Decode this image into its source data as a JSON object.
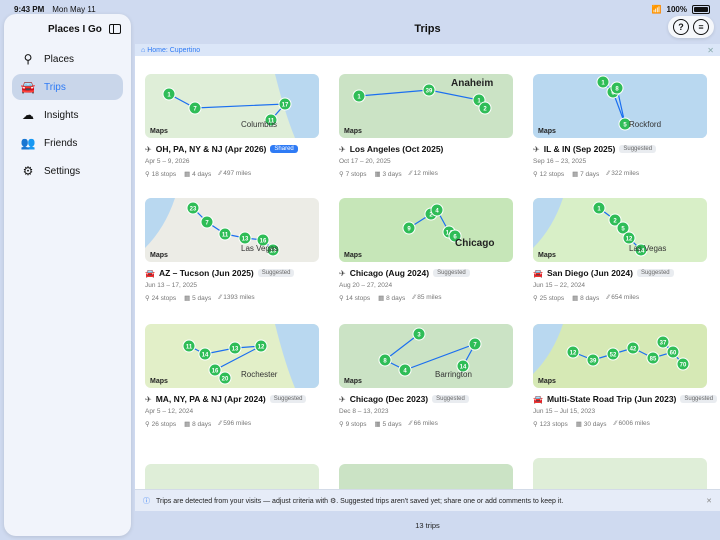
{
  "status": {
    "time": "9:43 PM",
    "date": "Mon May 11",
    "battery": "100%"
  },
  "sidebar": {
    "title": "Places I Go",
    "items": [
      {
        "label": "Places",
        "icon": "pin-icon",
        "glyph": "⚲"
      },
      {
        "label": "Trips",
        "icon": "car-icon",
        "glyph": "🚘"
      },
      {
        "label": "Insights",
        "icon": "brain-icon",
        "glyph": "☁"
      },
      {
        "label": "Friends",
        "icon": "people-icon",
        "glyph": "👥"
      },
      {
        "label": "Settings",
        "icon": "gear-icon",
        "glyph": "⚙"
      }
    ]
  },
  "header": {
    "title": "Trips",
    "help": "?",
    "menu": "≡"
  },
  "breadcrumb": {
    "label": "Home: Cupertino"
  },
  "cards": [
    {
      "title": "OH, PA, NY & NJ (Apr 2026)",
      "type": "plane",
      "badge": "Shared",
      "date": "Apr 5 – 9, 2026",
      "stops": "18 stops",
      "days": "4 days",
      "miles": "497 miles",
      "maptext": "Columbus"
    },
    {
      "title": "Los Angeles (Oct 2025)",
      "type": "plane",
      "badge": "",
      "date": "Oct 17 – 20, 2025",
      "stops": "7 stops",
      "days": "3 days",
      "miles": "12 miles",
      "maptext": "Anaheim"
    },
    {
      "title": "IL & IN (Sep 2025)",
      "type": "plane",
      "badge": "Suggested",
      "date": "Sep 16 – 23, 2025",
      "stops": "12 stops",
      "days": "7 days",
      "miles": "322 miles",
      "maptext": "Rockford"
    },
    {
      "title": "AZ – Tucson (Jun 2025)",
      "type": "car",
      "badge": "Suggested",
      "date": "Jun 13 – 17, 2025",
      "stops": "24 stops",
      "days": "5 days",
      "miles": "1393 miles",
      "maptext": "Las Vegas"
    },
    {
      "title": "Chicago (Aug 2024)",
      "type": "plane",
      "badge": "Suggested",
      "date": "Aug 20 – 27, 2024",
      "stops": "14 stops",
      "days": "8 days",
      "miles": "85 miles",
      "maptext": "Chicago"
    },
    {
      "title": "San Diego (Jun 2024)",
      "type": "car",
      "badge": "Suggested",
      "date": "Jun 15 – 22, 2024",
      "stops": "25 stops",
      "days": "8 days",
      "miles": "654 miles",
      "maptext": "Las Vegas"
    },
    {
      "title": "MA, NY, PA & NJ (Apr 2024)",
      "type": "plane",
      "badge": "Suggested",
      "date": "Apr 5 – 12, 2024",
      "stops": "26 stops",
      "days": "8 days",
      "miles": "596 miles",
      "maptext": "Rochester"
    },
    {
      "title": "Chicago (Dec 2023)",
      "type": "plane",
      "badge": "Suggested",
      "date": "Dec 8 – 13, 2023",
      "stops": "9 stops",
      "days": "5 days",
      "miles": "66 miles",
      "maptext": "Barrington"
    },
    {
      "title": "Multi-State Road Trip (Jun 2023)",
      "type": "car",
      "badge": "Suggested",
      "date": "Jun 15 – Jul 15, 2023",
      "stops": "123 stops",
      "days": "30 days",
      "miles": "6006 miles",
      "maptext": ""
    }
  ],
  "notice": {
    "text": "Trips are detected from your visits — adjust criteria with ⚙. Suggested trips aren't saved yet; share one or add comments to keep it."
  },
  "footer": {
    "count": "13 trips"
  },
  "colors": {
    "accent": "#2f7bf5",
    "pin": "#2fbd57",
    "road": "#1b6ff0"
  }
}
